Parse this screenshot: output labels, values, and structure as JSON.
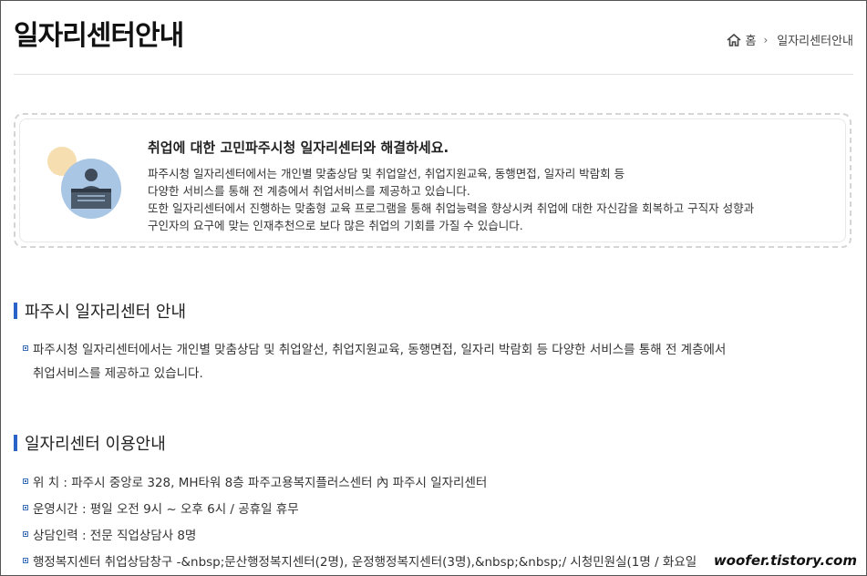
{
  "header": {
    "title": "일자리센터안내",
    "breadcrumb": {
      "home": "홈",
      "separator": "›",
      "current": "일자리센터안내"
    }
  },
  "intro": {
    "title": "취업에 대한 고민파주시청 일자리센터와 해결하세요.",
    "lines": [
      "파주시청 일자리센터에서는 개인별 맞춤상담 및 취업알선, 취업지원교육, 동행면접, 일자리 박람회 등",
      "다양한 서비스를 통해 전 계층에서 취업서비스를 제공하고 있습니다.",
      "또한 일자리센터에서 진행하는 맞춤형 교육 프로그램을 통해 취업능력을 향상시켜 취업에 대한 자신감을 회복하고 구직자 성향과",
      "구인자의 요구에 맞는 인재추천으로 보다 많은 취업의 기회를 가질 수 있습니다."
    ]
  },
  "section1": {
    "title": "파주시 일자리센터 안내",
    "line1": "파주시청 일자리센터에서는 개인별 맞춤상담 및 취업알선, 취업지원교육, 동행면접, 일자리 박람회 등 다양한 서비스를 통해 전 계층에서",
    "line2": "취업서비스를 제공하고 있습니다."
  },
  "section2": {
    "title": "일자리센터 이용안내",
    "items": [
      "위 치 : 파주시 중앙로 328, MH타워 8층 파주고용복지플러스센터 內 파주시 일자리센터",
      "운영시간 : 평일 오전 9시 ~ 오후 6시 / 공휴일 휴무",
      "상담인력 : 전문 직업상담사 8명",
      "행정복지센터 취업상담창구 -&nbsp;문산행정복지센터(2명), 운정행정복지센터(3명),&nbsp;&nbsp;/ 시청민원실(1명 / 화요일"
    ]
  },
  "watermark": "woofer.tistory.com",
  "colors": {
    "accent": "#2a63c7",
    "bullet": "#3d6fb6"
  }
}
